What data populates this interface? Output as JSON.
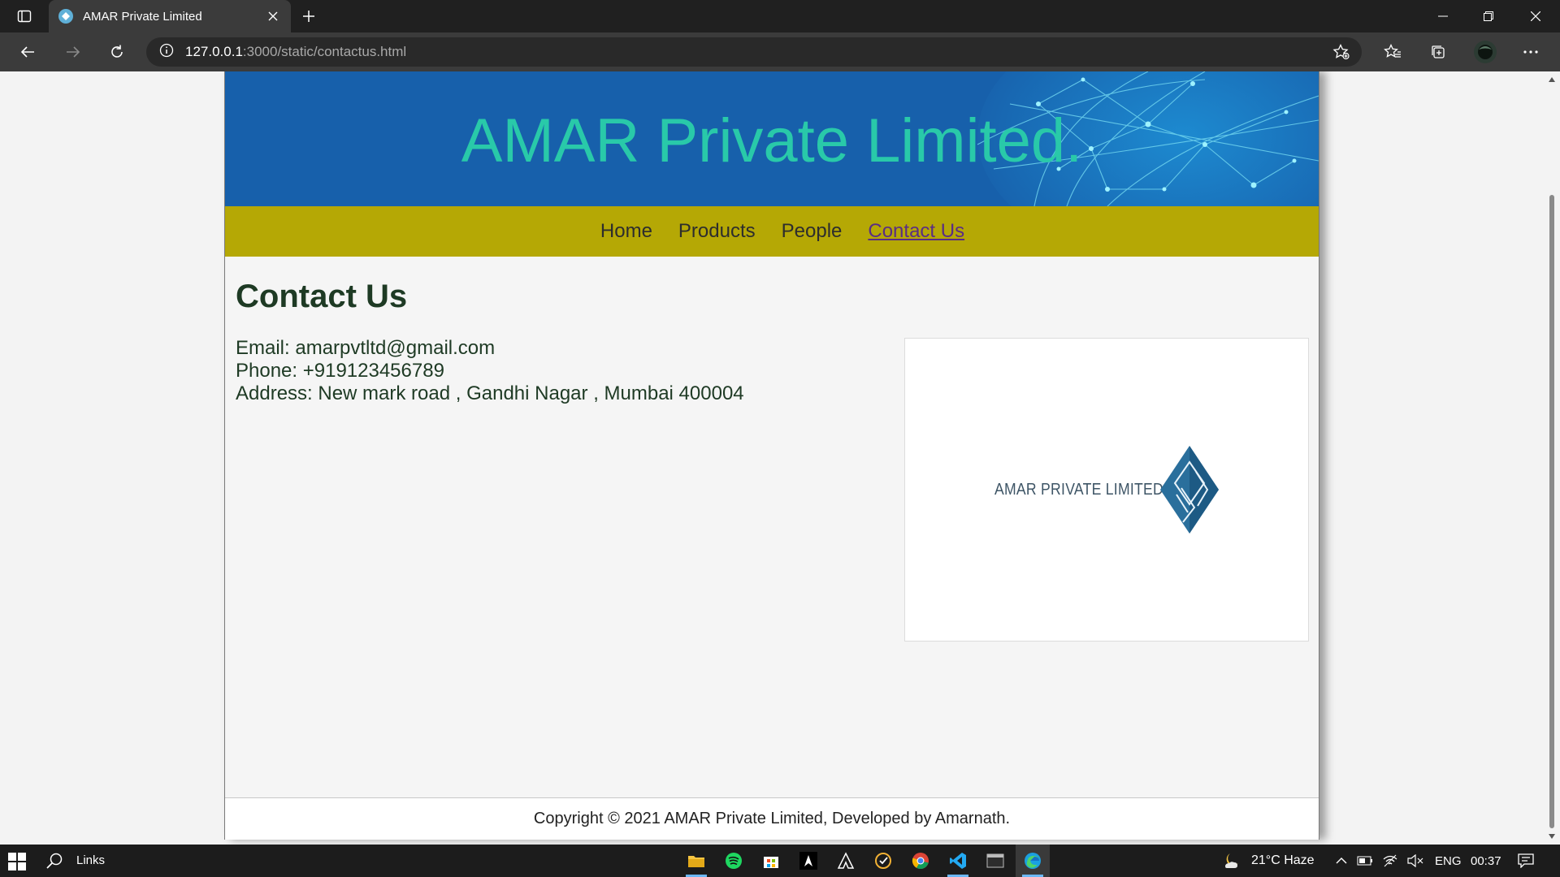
{
  "browser": {
    "tab_title": "AMAR Private Limited",
    "url_host": "127.0.0.1",
    "url_rest": ":3000/static/contactus.html"
  },
  "site": {
    "banner_title": "AMAR Private Limited.",
    "nav": [
      "Home",
      "Products",
      "People",
      "Contact Us"
    ],
    "page_heading": "Contact Us",
    "contact": {
      "email": "Email: amarpvtltd@gmail.com",
      "phone": "Phone: +919123456789",
      "address": "Address: New mark road , Gandhi Nagar , Mumbai 400004"
    },
    "logo_text": "AMAR PRIVATE LIMITED",
    "footer": "Copyright © 2021 AMAR Private Limited, Developed by Amarnath."
  },
  "taskbar": {
    "links_label": "Links",
    "weather": "21°C  Haze",
    "language": "ENG",
    "time": "00:37"
  },
  "colors": {
    "banner": "#1760ab",
    "banner_title": "#29c9a9",
    "nav_bar": "#b5a805",
    "heading_text": "#1e3a24",
    "active_link": "#5a2d84"
  }
}
